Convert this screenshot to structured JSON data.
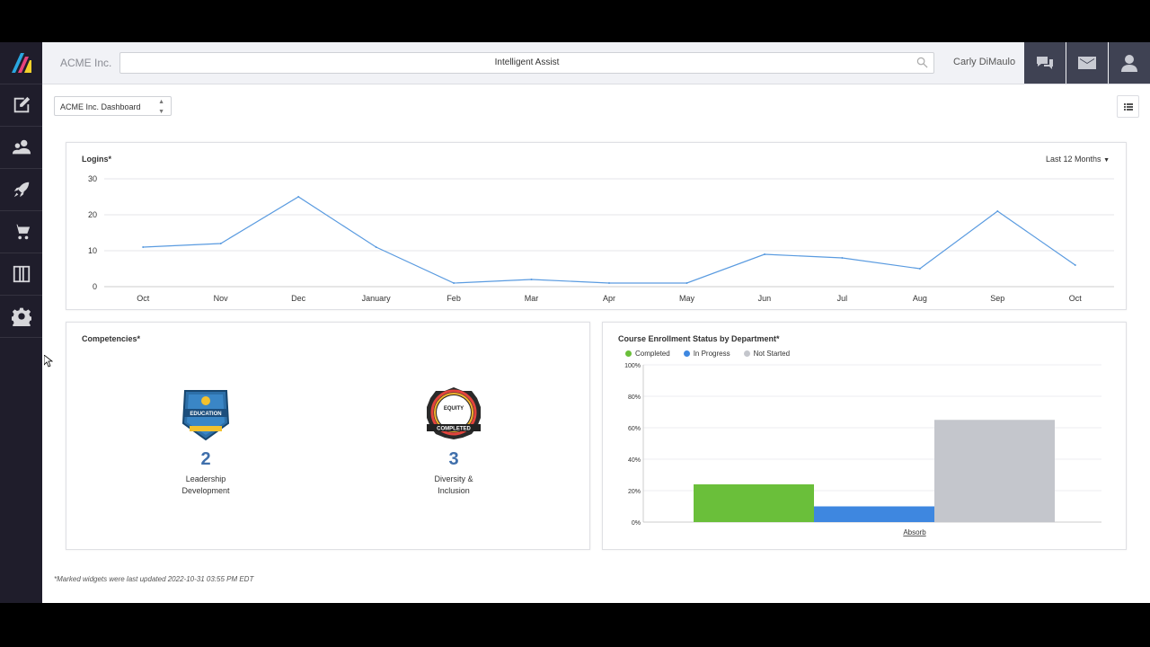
{
  "topbar": {
    "company": "ACME Inc.",
    "search_placeholder": "Intelligent Assist",
    "user_name": "Carly DiMaulo"
  },
  "sidebar": {
    "items": [
      {
        "name": "edit-icon"
      },
      {
        "name": "users-icon"
      },
      {
        "name": "rocket-icon"
      },
      {
        "name": "cart-icon"
      },
      {
        "name": "columns-icon"
      },
      {
        "name": "gear-icon"
      }
    ]
  },
  "dashboard_select": "ACME Inc. Dashboard",
  "logins": {
    "title": "Logins*",
    "period": "Last 12 Months"
  },
  "competencies": {
    "title": "Competencies*",
    "badges": [
      {
        "count": "2",
        "label_line1": "Leadership",
        "label_line2": "Development",
        "badge_text": "CONTINUING EDUCATION"
      },
      {
        "count": "3",
        "label_line1": "Diversity &",
        "label_line2": "Inclusion",
        "badge_text": "EQUITY DIVERSITY & INCLUSION TRAINING COMPLETED"
      }
    ]
  },
  "enrollment": {
    "title": "Course Enrollment Status by Department*",
    "legend": [
      "Completed",
      "In Progress",
      "Not Started"
    ]
  },
  "footer_note": "*Marked widgets were last updated 2022-10-31 03:55 PM EDT",
  "colors": {
    "completed": "#6abf3a",
    "in_progress": "#3e87e0",
    "not_started": "#c4c6cc",
    "line": "#5a9be0"
  },
  "chart_data": [
    {
      "type": "line",
      "title": "Logins*",
      "categories": [
        "Oct",
        "Nov",
        "Dec",
        "January",
        "Feb",
        "Mar",
        "Apr",
        "May",
        "Jun",
        "Jul",
        "Aug",
        "Sep",
        "Oct"
      ],
      "values": [
        11,
        12,
        25,
        11,
        1,
        2,
        1,
        1,
        9,
        8,
        5,
        21,
        6
      ],
      "ylim": [
        0,
        30
      ],
      "yticks": [
        0,
        10,
        20,
        30
      ],
      "grid": true
    },
    {
      "type": "bar",
      "title": "Course Enrollment Status by Department*",
      "categories": [
        "Absorb"
      ],
      "series": [
        {
          "name": "Completed",
          "values": [
            24
          ]
        },
        {
          "name": "In Progress",
          "values": [
            10
          ]
        },
        {
          "name": "Not Started",
          "values": [
            65
          ]
        }
      ],
      "ylim": [
        0,
        100
      ],
      "yticks": [
        "0%",
        "20%",
        "40%",
        "60%",
        "80%",
        "100%"
      ],
      "legend": "top-left",
      "grid": true
    }
  ]
}
